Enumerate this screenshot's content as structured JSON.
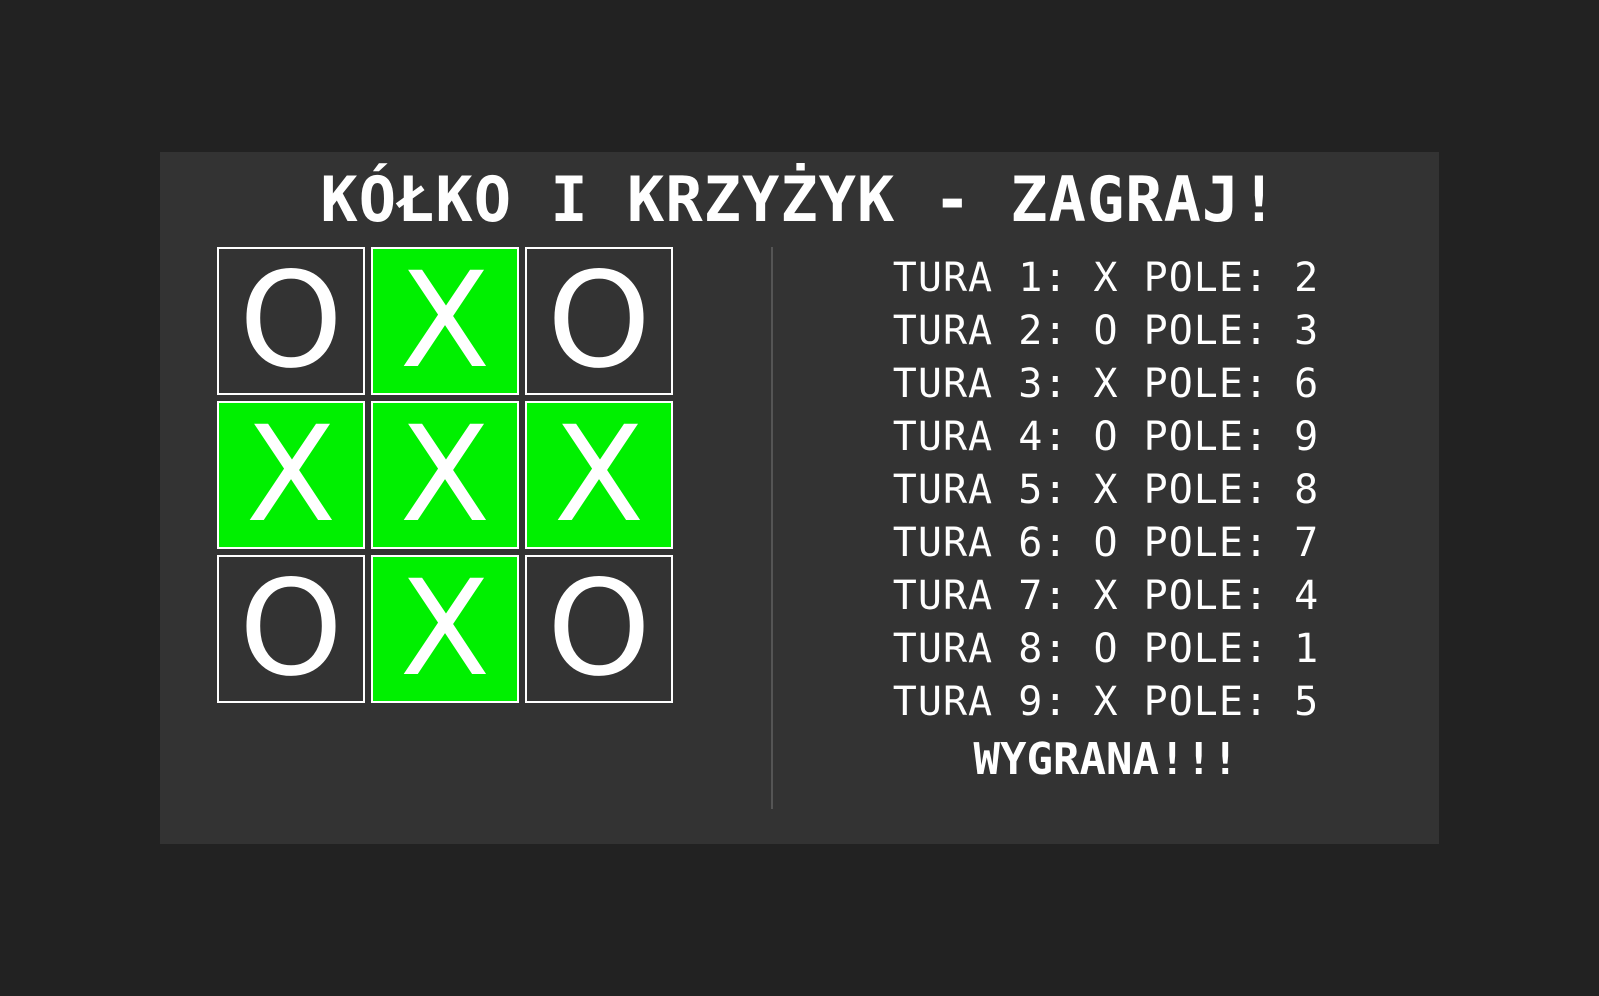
{
  "title": "KÓŁKO I KRZYŻYK - ZAGRAJ!",
  "colors": {
    "page_background": "#222222",
    "panel_background": "#333333",
    "winning_cell": "#00f000",
    "text": "#ffffff"
  },
  "board": {
    "cells": [
      {
        "mark": "O",
        "winning": false
      },
      {
        "mark": "X",
        "winning": true
      },
      {
        "mark": "O",
        "winning": false
      },
      {
        "mark": "X",
        "winning": true
      },
      {
        "mark": "X",
        "winning": true
      },
      {
        "mark": "X",
        "winning": true
      },
      {
        "mark": "O",
        "winning": false
      },
      {
        "mark": "X",
        "winning": true
      },
      {
        "mark": "O",
        "winning": false
      }
    ]
  },
  "moves": [
    "TURA 1: X POLE: 2",
    "TURA 2: O POLE: 3",
    "TURA 3: X POLE: 6",
    "TURA 4: O POLE: 9",
    "TURA 5: X POLE: 8",
    "TURA 6: O POLE: 7",
    "TURA 7: X POLE: 4",
    "TURA 8: O POLE: 1",
    "TURA 9: X POLE: 5"
  ],
  "result": "WYGRANA!!!"
}
